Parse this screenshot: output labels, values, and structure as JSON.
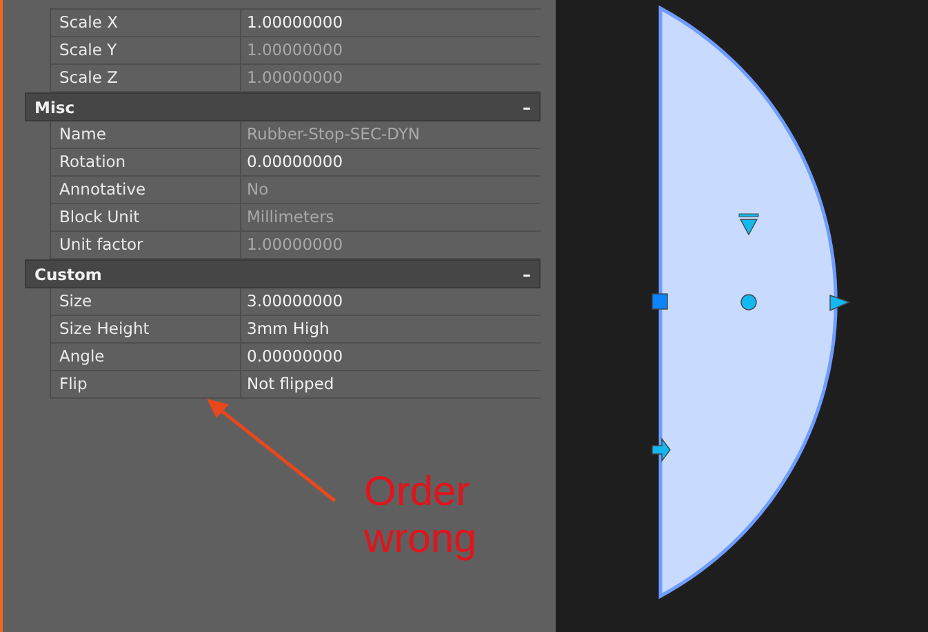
{
  "properties": {
    "sections": [
      {
        "rows": [
          {
            "label": "Scale X",
            "value": "1.00000000",
            "disabled": false
          },
          {
            "label": "Scale Y",
            "value": "1.00000000",
            "disabled": true
          },
          {
            "label": "Scale Z",
            "value": "1.00000000",
            "disabled": true
          }
        ]
      },
      {
        "title": "Misc",
        "collapse_symbol": "–",
        "rows": [
          {
            "label": "Name",
            "value": "Rubber-Stop-SEC-DYN",
            "disabled": true
          },
          {
            "label": "Rotation",
            "value": "0.00000000",
            "disabled": false
          },
          {
            "label": "Annotative",
            "value": "No",
            "disabled": true
          },
          {
            "label": "Block Unit",
            "value": "Millimeters",
            "disabled": true
          },
          {
            "label": "Unit factor",
            "value": "1.00000000",
            "disabled": true
          }
        ]
      },
      {
        "title": "Custom",
        "collapse_symbol": "–",
        "rows": [
          {
            "label": "Size",
            "value": "3.00000000",
            "disabled": false
          },
          {
            "label": "Size Height",
            "value": "3mm High",
            "disabled": false
          },
          {
            "label": "Angle",
            "value": "0.00000000",
            "disabled": false
          },
          {
            "label": "Flip",
            "value": "Not flipped",
            "disabled": false
          }
        ]
      }
    ]
  },
  "annotation": {
    "lines": [
      "Order",
      "wrong"
    ]
  }
}
